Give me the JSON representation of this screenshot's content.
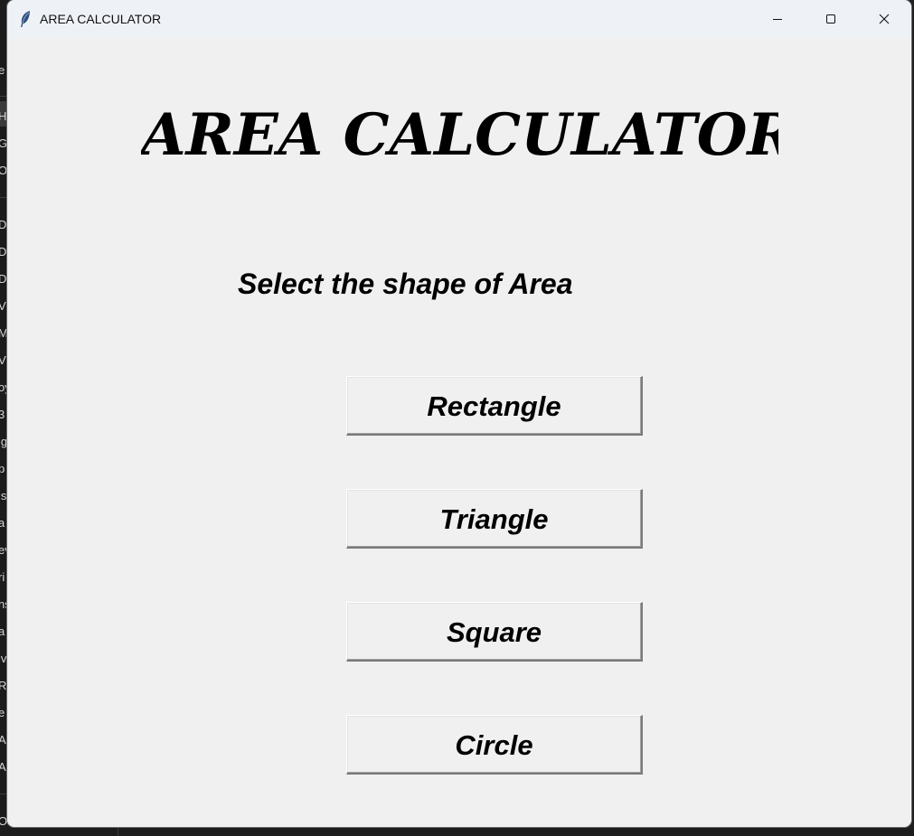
{
  "window": {
    "title": "AREA CALCULATOR"
  },
  "main": {
    "heading": "AREA CALCULATOR",
    "prompt": "Select the shape of Area",
    "buttons": [
      {
        "label": "Rectangle"
      },
      {
        "label": "Triangle"
      },
      {
        "label": "Square"
      },
      {
        "label": "Circle"
      }
    ]
  },
  "background_window": {
    "sidebar_fragments": [
      "e",
      "Ho",
      "Ga",
      "On",
      "De",
      "Dc",
      "Dc",
      "Vi",
      "M",
      "Vi",
      "oy",
      "3",
      "lg",
      "p",
      "ls",
      "a",
      "ev",
      "ri",
      "ns",
      "a",
      "iv",
      "RE",
      "e",
      "A",
      "A",
      "On"
    ]
  },
  "colors": {
    "window_bg": "#f0f0f0",
    "titlebar_bg": "#eef1f6",
    "text": "#000000"
  },
  "icons": {
    "app": "feather-icon",
    "minimize": "minimize-icon",
    "maximize": "maximize-icon",
    "close": "close-icon"
  }
}
